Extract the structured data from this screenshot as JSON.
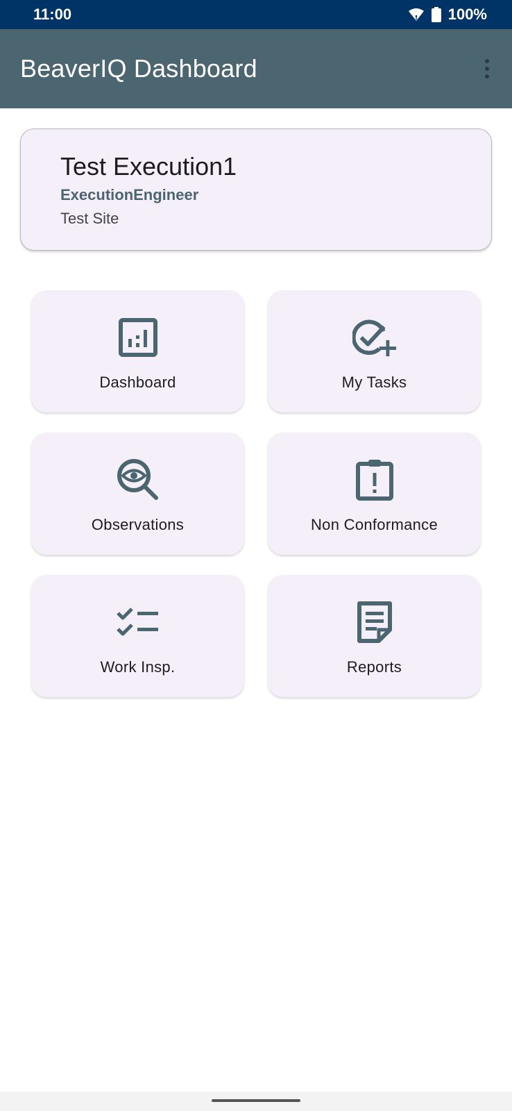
{
  "status_bar": {
    "time": "11:00",
    "battery": "100%",
    "icons": [
      "wifi-icon",
      "battery-icon"
    ]
  },
  "app_bar": {
    "title": "BeaverIQ Dashboard",
    "menu_icon": "more-vert-icon"
  },
  "profile": {
    "name": "Test Execution1",
    "role": "ExecutionEngineer",
    "site": "Test Site"
  },
  "tiles": [
    {
      "label": "Dashboard",
      "icon": "bar-chart-icon"
    },
    {
      "label": "My Tasks",
      "icon": "task-add-icon"
    },
    {
      "label": "Observations",
      "icon": "eye-search-icon"
    },
    {
      "label": "Non Conformance",
      "icon": "clipboard-alert-icon"
    },
    {
      "label": "Work Insp.",
      "icon": "checklist-icon"
    },
    {
      "label": "Reports",
      "icon": "report-document-icon"
    }
  ],
  "colors": {
    "status_bar": "#003366",
    "app_bar": "#4b6571",
    "card_bg": "#f4eff8",
    "icon": "#4b6571",
    "accent_text": "#4b6571"
  }
}
